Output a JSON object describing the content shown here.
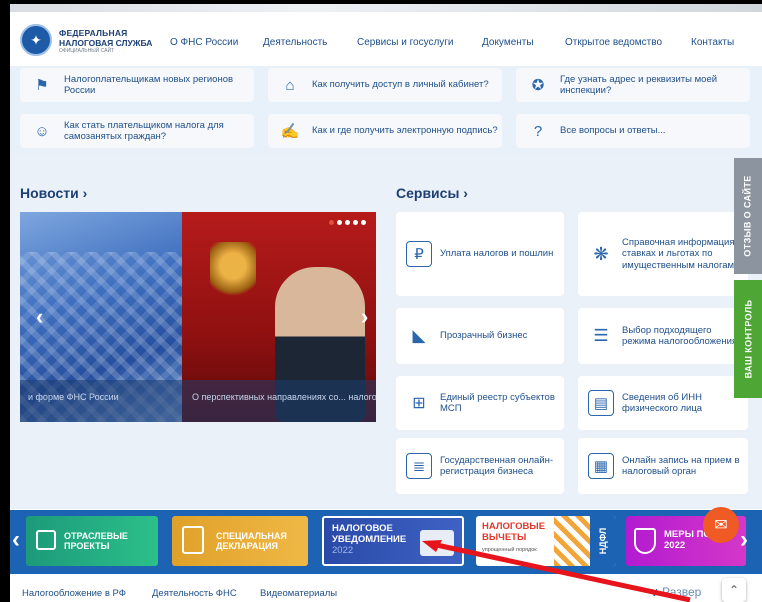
{
  "header": {
    "brand_line1": "ФЕДЕРАЛЬНАЯ",
    "brand_line2": "НАЛОГОВАЯ СЛУЖБА",
    "brand_line3": "ОФИЦИАЛЬНЫЙ САЙТ",
    "nav": [
      "О ФНС России",
      "Деятельность",
      "Сервисы и госуслуги",
      "Документы",
      "Открытое ведомство",
      "Контакты"
    ]
  },
  "faq": [
    {
      "icon": "flag-icon",
      "text": "Налогоплательщикам новых регионов России"
    },
    {
      "icon": "lock-icon",
      "text": "Как получить доступ в личный кабинет?"
    },
    {
      "icon": "emblem-icon",
      "text": "Где узнать адрес и реквизиты моей инспекции?"
    },
    {
      "icon": "people-icon",
      "text": "Как стать плательщиком налога для самозанятых граждан?"
    },
    {
      "icon": "signature-icon",
      "text": "Как и где получить электронную подпись?"
    },
    {
      "icon": "question-icon",
      "text": "Все вопросы и ответы..."
    }
  ],
  "news": {
    "title": "Новости ›",
    "caption_left": "и форме ФНС России",
    "caption_right": "О перспективных направлениях со... налогообложения имущественн..."
  },
  "services": {
    "title": "Сервисы ›",
    "items": [
      {
        "icon": "payment-icon",
        "text": "Уплата налогов и пошлин"
      },
      {
        "icon": "rates-icon",
        "text": "Справочная информация о ставках и льготах по имущественным налогам"
      },
      {
        "icon": "flashlight-icon",
        "text": "Прозрачный бизнес"
      },
      {
        "icon": "sliders-icon",
        "text": "Выбор подходящего режима налогообложения"
      },
      {
        "icon": "registry-icon",
        "text": "Единый реестр субъектов МСП"
      },
      {
        "icon": "inn-icon",
        "text": "Сведения об ИНН физического лица"
      },
      {
        "icon": "registration-icon",
        "text": "Государственная онлайн-регистрация бизнеса"
      },
      {
        "icon": "appointment-icon",
        "text": "Онлайн запись на прием в налоговый орган"
      }
    ]
  },
  "side_tabs": {
    "feedback": "ОТЗЫВ О САЙТЕ",
    "control": "ВАШ КОНТРОЛЬ"
  },
  "banners": [
    {
      "text1": "ОТРАСЛЕВЫЕ",
      "text2": "ПРОЕКТЫ"
    },
    {
      "text1": "СПЕЦИАЛЬНАЯ",
      "text2": "ДЕКЛАРАЦИЯ"
    },
    {
      "text1": "НАЛОГОВОЕ",
      "text2": "УВЕДОМЛЕНИЕ",
      "text3": "2022"
    },
    {
      "text1": "НАЛОГОВЫЕ",
      "text2": "ВЫЧЕТЫ",
      "text3": "упрощенный порядок",
      "text4": "НДФЛ"
    },
    {
      "text1": "МЕРЫ ПО",
      "text2": "2022"
    }
  ],
  "footer": {
    "links": [
      "Налогообложение в РФ",
      "Деятельность ФНС",
      "Видеоматериалы"
    ],
    "expand": "Развер"
  },
  "colors": {
    "primary": "#1d3f73",
    "link": "#1f4f8a",
    "annotation": "#e8141b"
  }
}
